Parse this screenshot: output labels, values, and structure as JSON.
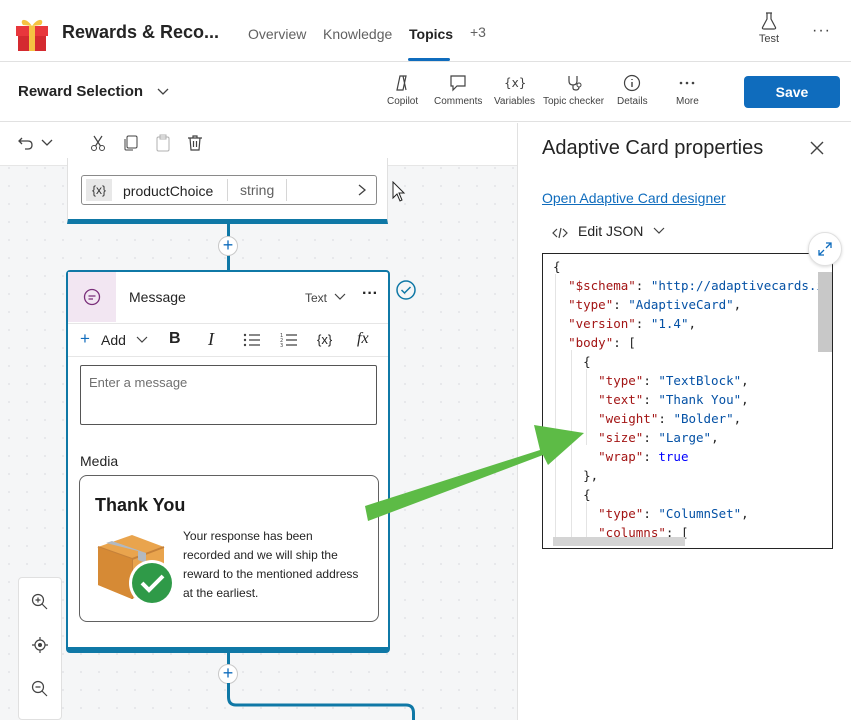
{
  "header": {
    "app_title": "Rewards & Reco...",
    "tabs": [
      {
        "label": "Overview"
      },
      {
        "label": "Knowledge"
      },
      {
        "label": "Topics"
      },
      {
        "label": "+3"
      }
    ],
    "test_label": "Test"
  },
  "topic_bar": {
    "topic_name": "Reward Selection",
    "tools": [
      {
        "label": "Copilot"
      },
      {
        "label": "Comments"
      },
      {
        "label": "Variables"
      },
      {
        "label": "Topic checker"
      },
      {
        "label": "Details"
      },
      {
        "label": "More"
      }
    ],
    "save_label": "Save"
  },
  "canvas": {
    "variable": {
      "icon_text": "{x}",
      "name": "productChoice",
      "type": "string"
    },
    "message_node": {
      "title": "Message",
      "format": "Text",
      "add_label": "Add",
      "var_symbol": "{x}",
      "input_placeholder": "Enter a message",
      "media_label": "Media",
      "card_title": "Thank You",
      "card_body": "Your response has been recorded and we will ship the reward to the mentioned address at the earliest."
    }
  },
  "panel": {
    "title": "Adaptive Card properties",
    "designer_link": "Open Adaptive Card designer",
    "edit_json_label": "Edit JSON",
    "json_lines": [
      "{",
      "  \"$schema\": \"http://adaptivecards.io",
      "  \"type\": \"AdaptiveCard\",",
      "  \"version\": \"1.4\",",
      "  \"body\": [",
      "    {",
      "      \"type\": \"TextBlock\",",
      "      \"text\": \"Thank You\",",
      "      \"weight\": \"Bolder\",",
      "      \"size\": \"Large\",",
      "      \"wrap\": true",
      "    },",
      "    {",
      "      \"type\": \"ColumnSet\",",
      "      \"columns\": ["
    ]
  },
  "colors": {
    "accent": "#0f6cbd",
    "node_border": "#0f78a6",
    "arrow": "#5dbb46"
  }
}
